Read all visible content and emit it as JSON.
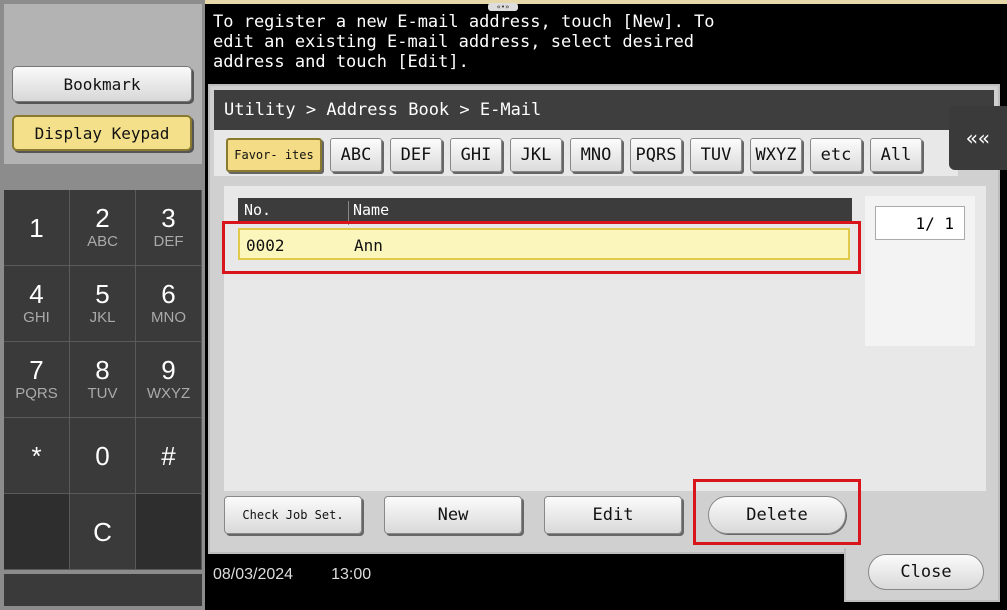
{
  "message": "To register a new E-mail address, touch [New]. To edit an existing E-mail address, select desired address and touch [Edit].",
  "top_handle": "«•»",
  "sidebar": {
    "bookmark_label": "Bookmark",
    "keypad_label": "Display Keypad"
  },
  "keypad": [
    {
      "num": "1",
      "sub": ""
    },
    {
      "num": "2",
      "sub": "ABC"
    },
    {
      "num": "3",
      "sub": "DEF"
    },
    {
      "num": "4",
      "sub": "GHI"
    },
    {
      "num": "5",
      "sub": "JKL"
    },
    {
      "num": "6",
      "sub": "MNO"
    },
    {
      "num": "7",
      "sub": "PQRS"
    },
    {
      "num": "8",
      "sub": "TUV"
    },
    {
      "num": "9",
      "sub": "WXYZ"
    },
    {
      "num": "*",
      "sub": ""
    },
    {
      "num": "0",
      "sub": ""
    },
    {
      "num": "#",
      "sub": ""
    },
    {
      "num": "",
      "sub": ""
    },
    {
      "num": "C",
      "sub": ""
    },
    {
      "num": "",
      "sub": ""
    }
  ],
  "breadcrumb": "Utility > Address Book > E-Mail",
  "tabs": {
    "favorites": "Favor- ites",
    "abc": "ABC",
    "def": "DEF",
    "ghi": "GHI",
    "jkl": "JKL",
    "mno": "MNO",
    "pqrs": "PQRS",
    "tuv": "TUV",
    "wxyz": "WXYZ",
    "etc": "etc",
    "all": "All"
  },
  "list": {
    "col_no": "No.",
    "col_name": "Name",
    "rows": [
      {
        "no": "0002",
        "name": "Ann"
      }
    ]
  },
  "pager": "1/ 1",
  "actions": {
    "check_job": "Check Job Set.",
    "new": "New",
    "edit": "Edit",
    "delete": "Delete"
  },
  "status": {
    "date": "08/03/2024",
    "time": "13:00"
  },
  "close_label": "Close",
  "back_icon": "««",
  "colors": {
    "highlight": "#d8141c",
    "selected_row": "#fbf6bc",
    "accent_yellow": "#f3dc85"
  }
}
